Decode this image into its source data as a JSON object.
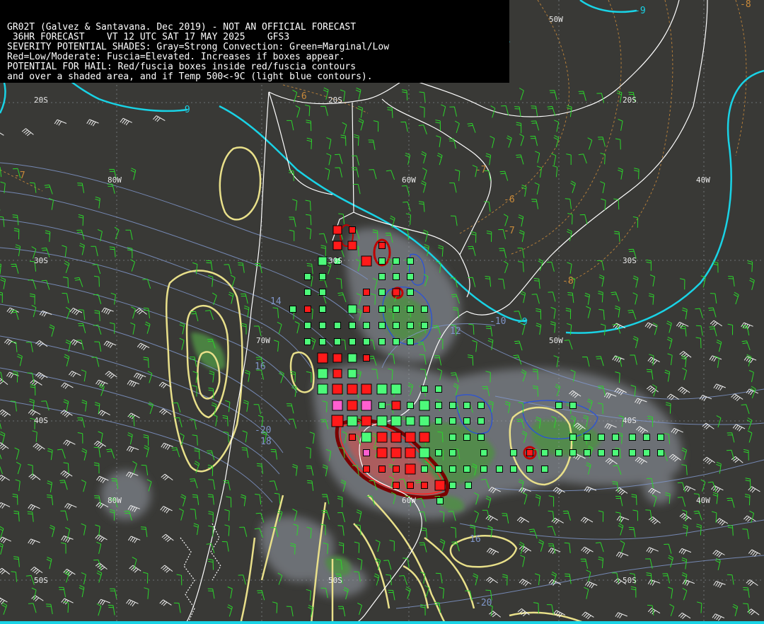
{
  "header": {
    "lines": [
      "GR02T (Galvez & Santavana. Dec 2019) - NOT AN OFFICIAL FORECAST",
      " 36HR FORECAST    VT 12 UTC SAT 17 MAY 2025    GFS3",
      "SEVERITY POTENTIAL SHADES: Gray=Strong Convection: Green=Marginal/Low",
      "Red=Low/Moderate: Fuscia=Elevated. Increases if boxes appear.",
      "POTENTIAL FOR HAIL: Red/fuscia boxes inside red/fuscia contours",
      "and over a shaded area, and if Temp 500<-9C (light blue contours)."
    ]
  },
  "grid_labels": {
    "lon_80w_top": "80W",
    "lon_60w_top": "60W",
    "lon_50w_top": "50W",
    "lon_40w_top": "40W",
    "lat_20s_left": "20S",
    "lat_20s_mid": "20S",
    "lat_20s_right": "20S",
    "lat_30s_left": "30S",
    "lat_30s_mid": "30S",
    "lat_30s_right": "30S",
    "lon_70w": "70W",
    "lon_50w_mid": "50W",
    "lat_40s_left": "40S",
    "lat_40s_right": "40S",
    "lon_80w_bottom": "80W",
    "lon_60w_bottom": "60W",
    "lon_40w_bottom": "40W",
    "lat_50s_left": "50S",
    "lat_50s_mid": "50S",
    "lat_50s_right": "50S"
  },
  "contour_labels": {
    "t500_top": "-9",
    "t500_left": "-9",
    "t500_right_a": "-10",
    "t500_right_b": "-9",
    "t_orange_a": "-7",
    "t_orange_b": "-6",
    "t_orange_c": "-7",
    "t_orange_d": "-6",
    "t_orange_e": "-7",
    "t_orange_f": "-8",
    "t_orange_g": "-8",
    "blue_14": "14",
    "blue_16": "16",
    "blue_18": "18",
    "blue_20a": "-20",
    "blue_20b": "-20",
    "blue_12": "12",
    "blue_16b": "16"
  },
  "colors": {
    "background": "#393936",
    "cyan_contour": "#19d3e6",
    "yellow_contour": "#e9e08a",
    "blue_contour": "#7f95c8",
    "orange_contour": "#c98a3a",
    "green_wind": "#2bd62b",
    "white_wind": "#f0f0f0",
    "gray_shade": "#72767c",
    "green_shade": "#4f8f45",
    "red_shade": "#b85a5a",
    "box_green": "#4dfa7a",
    "box_red": "#ff1a1a",
    "box_fuscia": "#ff5fd0"
  },
  "symbols": {
    "box_marginal": "green-square",
    "box_moderate": "red-square",
    "box_elevated": "fuscia-square"
  }
}
